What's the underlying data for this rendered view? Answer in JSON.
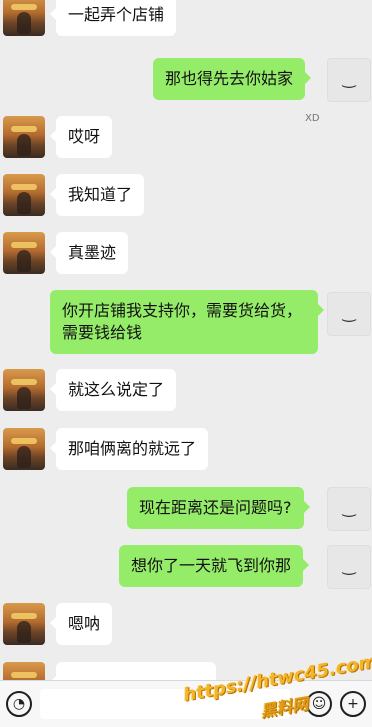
{
  "messages": [
    {
      "side": "left",
      "text": "一起弄个店铺"
    },
    {
      "side": "right",
      "text": "那也得先去你姑家"
    },
    {
      "side": "left",
      "text": "哎呀"
    },
    {
      "side": "left",
      "text": "我知道了"
    },
    {
      "side": "left",
      "text": "真墨迹"
    },
    {
      "side": "right",
      "text": "你开店铺我支持你，需要货给货，需要钱给钱"
    },
    {
      "side": "left",
      "text": "就这么说定了"
    },
    {
      "side": "left",
      "text": "那咱俩离的就远了"
    },
    {
      "side": "right",
      "text": "现在距离还是问题吗?"
    },
    {
      "side": "right",
      "text": "想你了一天就飞到你那"
    },
    {
      "side": "left",
      "text": "嗯呐"
    }
  ],
  "watermark": {
    "line1": "https://htwc45.com",
    "line2": "黑料网"
  },
  "avatar_overlay_text": "XD"
}
